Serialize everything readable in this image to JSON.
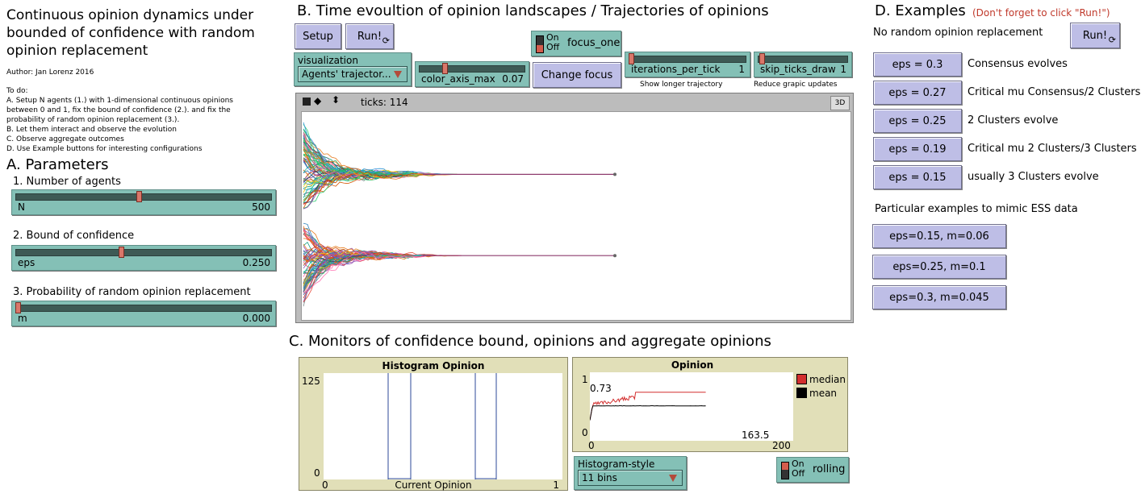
{
  "title_lines": [
    "Continuous opinion dynamics under",
    "bounded of confidence with random",
    "opinion replacement"
  ],
  "author": "Author: Jan Lorenz 2016",
  "todo_lines": [
    "To do:",
    "A. Setup N agents (1.) with 1-dimensional continuous opinions",
    "between 0 and 1, fix the bound of confidence (2.). and fix the",
    "probability of random opinion replacement (3.).",
    "B. Let them interact and observe the evolution",
    "C. Observe aggregate outcomes",
    "D. Use Example buttons for interesting configurations"
  ],
  "section_a": {
    "heading": "A. Parameters",
    "p1_label": "1. Number of agents",
    "p2_label": "2. Bound of confidence",
    "p3_label": "3. Probability of random opinion replacement",
    "sliders": [
      {
        "name": "N",
        "value": "500",
        "fraction": 0.48
      },
      {
        "name": "eps",
        "value": "0.250",
        "fraction": 0.41
      },
      {
        "name": "m",
        "value": "0.000",
        "fraction": 0.0
      }
    ]
  },
  "section_b": {
    "heading": "B. Time evoultion of opinion landscapes / Trajectories of opinions",
    "setup_label": "Setup",
    "run_label": "Run!",
    "forever_glyph": "⟳",
    "visualization_label": "visualization",
    "visualization_value": "Agents' trajector...",
    "color_axis_name": "color_axis_max",
    "color_axis_value": "0.07",
    "color_axis_fraction": 0.07,
    "switch_on": "On",
    "switch_off": "Off",
    "focus_one_label": "focus_one",
    "change_focus_label": "Change focus",
    "iter_name": "iterations_per_tick",
    "iter_value": "1",
    "iter_caption": "Show longer trajectory",
    "skip_name": "skip_ticks_draw",
    "skip_value": "1",
    "skip_caption": "Reduce grapic updates",
    "ticks_text": "ticks: 114",
    "btn_3d": "3D",
    "cluster_opinions": [
      0.71,
      0.3
    ]
  },
  "section_c": {
    "heading": "C. Monitors of confidence bound, opinions and aggregate opinions",
    "histogram_title": "Histogram Opinion",
    "hist_ymax": "125",
    "hist_ymin": "0",
    "hist_xmin": "0",
    "hist_xmax": "1",
    "hist_xlabel": "Current Opinion",
    "opinion_title": "Opinion",
    "op_ymax": "1",
    "op_ymin": "0",
    "op_xmin": "0",
    "op_xmax": "200",
    "op_value_label": "0.73",
    "op_x_readout": "163.5",
    "legend": [
      {
        "name": "median",
        "color": "#d32f2f"
      },
      {
        "name": "mean",
        "color": "#000000"
      }
    ],
    "histogram_style_label": "Histogram-style",
    "histogram_style_value": "11 bins",
    "rolling_label": "rolling"
  },
  "section_d": {
    "heading": "D. Examples",
    "note": "(Don't forget to click \"Run!\")",
    "no_replacement": "No random opinion replacement",
    "run_label": "Run!",
    "examples": [
      {
        "button": "eps = 0.3",
        "desc": "Consensus evolves"
      },
      {
        "button": "eps = 0.27",
        "desc": "Critical mu Consensus/2 Clusters"
      },
      {
        "button": "eps = 0.25",
        "desc": "2 Clusters evolve"
      },
      {
        "button": "eps = 0.19",
        "desc": "Critical mu 2 Clusters/3 Clusters"
      },
      {
        "button": "eps = 0.15",
        "desc": "usually 3 Clusters evolve"
      }
    ],
    "ess_label": "Particular examples to mimic ESS data",
    "ess_buttons": [
      "eps=0.15, m=0.06",
      "eps=0.25, m=0.1",
      "eps=0.3, m=0.045"
    ]
  },
  "colors": {
    "button": "#bebee6",
    "widget": "#84c0b6",
    "plot": "#e1dfb8",
    "note_red": "#c0392b"
  }
}
